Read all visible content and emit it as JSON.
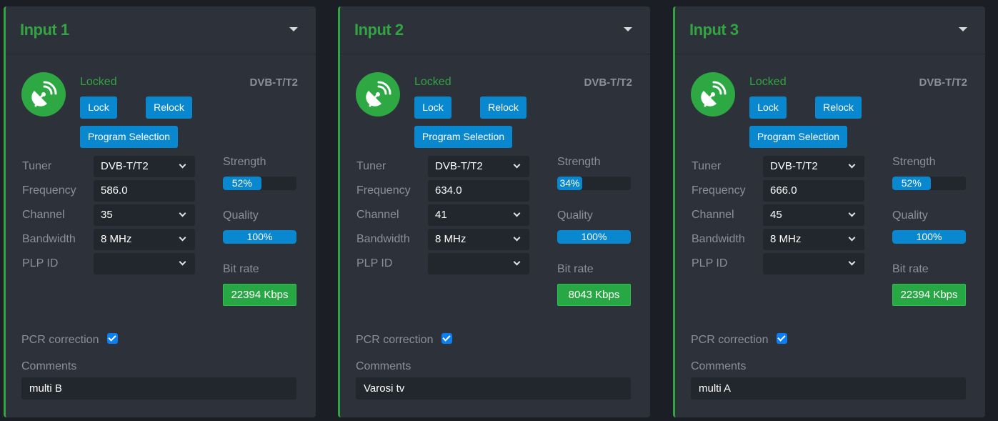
{
  "field_labels": {
    "tuner": "Tuner",
    "frequency": "Frequency",
    "channel": "Channel",
    "bandwidth": "Bandwidth",
    "plp_id": "PLP ID",
    "strength": "Strength",
    "quality": "Quality",
    "bit_rate": "Bit rate",
    "pcr_correction": "PCR correction",
    "comments": "Comments"
  },
  "buttons": {
    "lock": "Lock",
    "relock": "Relock",
    "program_selection": "Program Selection"
  },
  "colors": {
    "accent_green": "#33a442",
    "button_blue": "#0a88cf",
    "panel_bg": "#2c313a",
    "page_bg": "#1b1e24"
  },
  "inputs": [
    {
      "title": "Input 1",
      "status": "Locked",
      "standard": "DVB-T/T2",
      "tuner": "DVB-T/T2",
      "frequency": "586.0",
      "channel": "35",
      "bandwidth": "8 MHz",
      "plp_id": "",
      "strength_pct": 52,
      "strength_label": "52%",
      "quality_pct": 100,
      "quality_label": "100%",
      "bit_rate": "22394 Kbps",
      "pcr_correction": true,
      "comments": "multi B"
    },
    {
      "title": "Input 2",
      "status": "Locked",
      "standard": "DVB-T/T2",
      "tuner": "DVB-T/T2",
      "frequency": "634.0",
      "channel": "41",
      "bandwidth": "8 MHz",
      "plp_id": "",
      "strength_pct": 34,
      "strength_label": "34%",
      "quality_pct": 100,
      "quality_label": "100%",
      "bit_rate": "8043 Kbps",
      "pcr_correction": true,
      "comments": "Varosi tv"
    },
    {
      "title": "Input 3",
      "status": "Locked",
      "standard": "DVB-T/T2",
      "tuner": "DVB-T/T2",
      "frequency": "666.0",
      "channel": "45",
      "bandwidth": "8 MHz",
      "plp_id": "",
      "strength_pct": 52,
      "strength_label": "52%",
      "quality_pct": 100,
      "quality_label": "100%",
      "bit_rate": "22394 Kbps",
      "pcr_correction": true,
      "comments": "multi A"
    }
  ]
}
